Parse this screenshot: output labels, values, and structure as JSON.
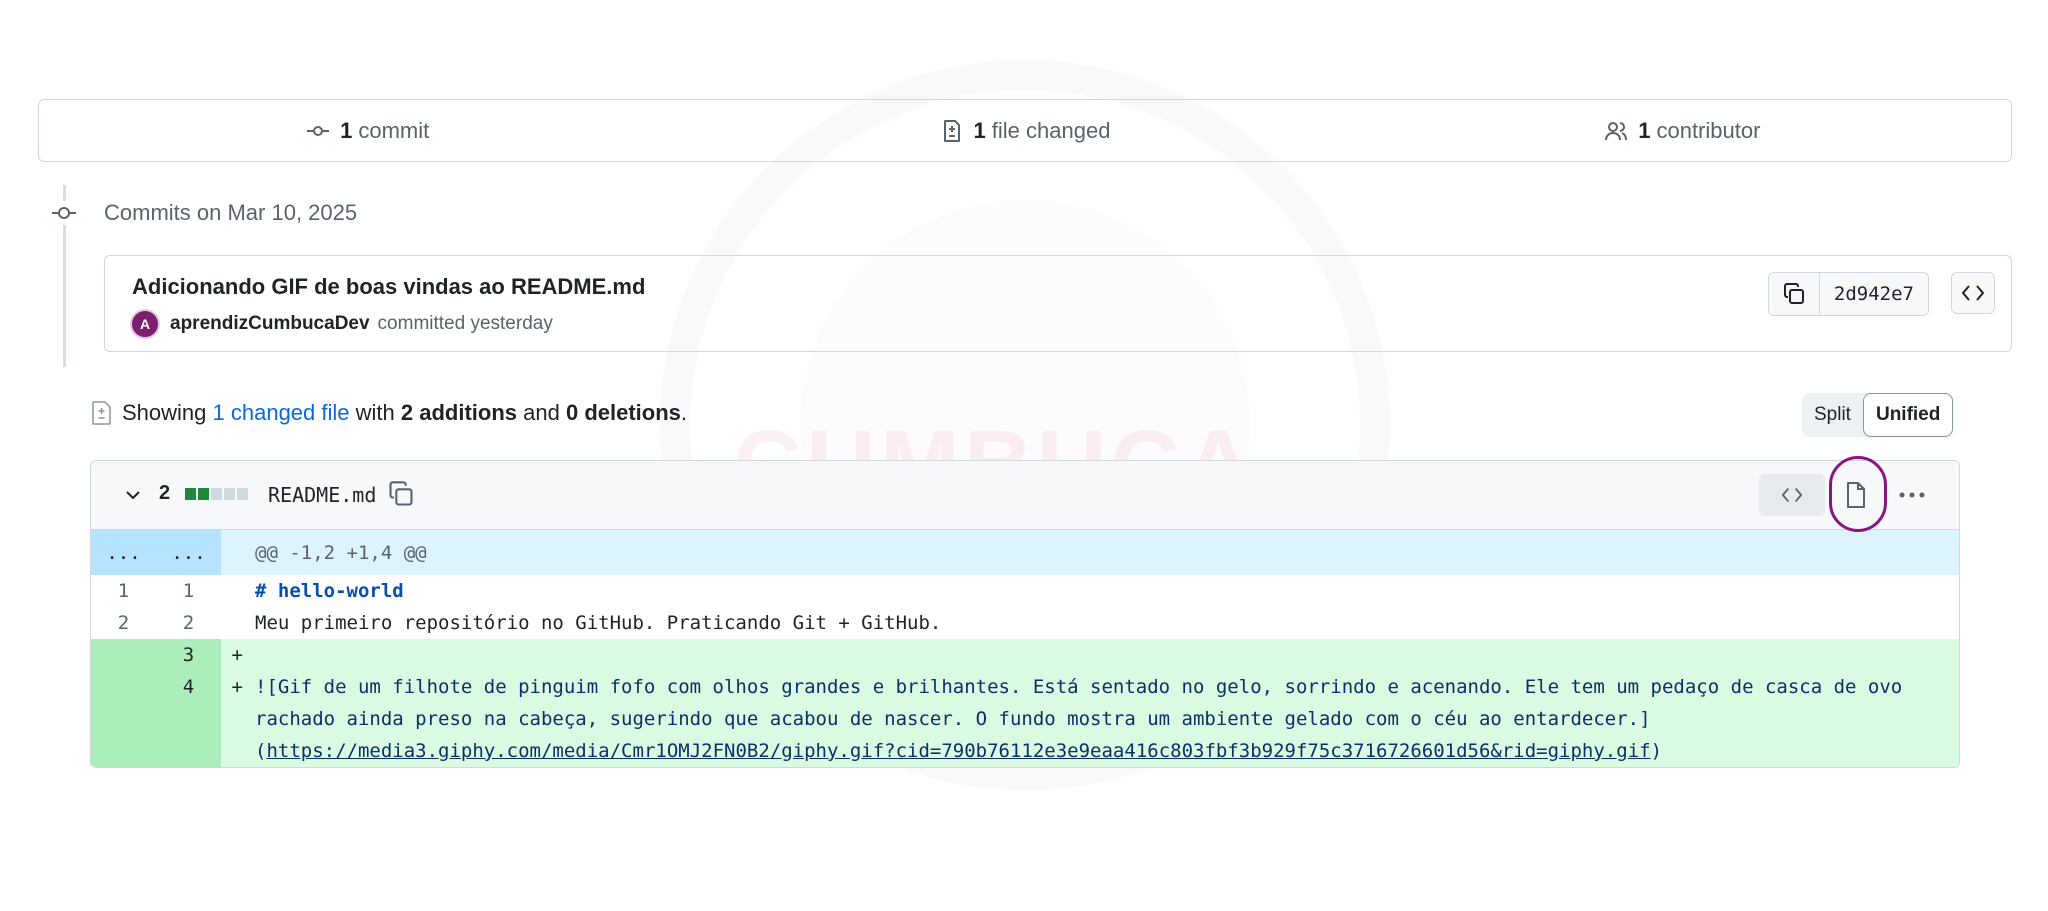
{
  "summary": {
    "commits_count": "1",
    "commits_label": "commit",
    "files_count": "1",
    "files_label": "file changed",
    "contributors_count": "1",
    "contributors_label": "contributor"
  },
  "timeline": {
    "date_heading": "Commits on Mar 10, 2025"
  },
  "commit": {
    "title": "Adicionando GIF de boas vindas ao README.md",
    "author": "aprendizCumbucaDev",
    "action": "committed yesterday",
    "sha": "2d942e7"
  },
  "showing": {
    "prefix": "Showing",
    "link": "1 changed file",
    "with": "with",
    "additions": "2 additions",
    "and": "and",
    "deletions": "0 deletions",
    "period": "."
  },
  "view_toggle": {
    "split": "Split",
    "unified": "Unified",
    "selected": "Unified"
  },
  "file": {
    "change_count": "2",
    "name": "README.md",
    "diffstat": [
      "add",
      "add",
      "neutral",
      "neutral",
      "neutral"
    ]
  },
  "diff": {
    "hunk_old": "...",
    "hunk_new": "...",
    "hunk_header": "@@ -1,2 +1,4 @@",
    "lines": [
      {
        "old": "1",
        "new": "1",
        "sign": "",
        "text": "# hello-world"
      },
      {
        "old": "2",
        "new": "2",
        "sign": "",
        "text": "Meu primeiro repositório no GitHub. Praticando Git + GitHub."
      },
      {
        "old": "",
        "new": "3",
        "sign": "+",
        "text": ""
      },
      {
        "old": "",
        "new": "4",
        "sign": "+",
        "text_prefix": "![Gif de um filhote de pinguim fofo com olhos grandes e brilhantes. Está sentado no gelo, sorrindo e acenando. Ele tem um pedaço de casca de ovo rachado ainda preso na cabeça, sugerindo que acabou de nascer. O fundo mostra um ambiente gelado com o céu ao entardecer.](",
        "link": "https://media3.giphy.com/media/Cmr1OMJ2FN0B2/giphy.gif?cid=790b76112e3e9eaa416c803fbf3b929f75c3716726601d56&rid=giphy.gif",
        "text_suffix": ")"
      }
    ]
  },
  "watermark": {
    "text": "CUMBUCA DEV"
  },
  "colors": {
    "accent": "#0969da",
    "add_bg": "#dafbe1",
    "add_num_bg": "#aceebb",
    "hunk_bg": "#ddf4ff",
    "diffstat_add": "#1f883d",
    "diffstat_neutral": "#d1d9e0",
    "highlight": "#8a1580"
  },
  "icons": {
    "commit": "git-commit-icon",
    "file_diff": "file-diff-icon",
    "people": "people-icon",
    "copy": "copy-icon",
    "code": "code-icon",
    "chevron": "chevron-down-icon",
    "file": "file-icon",
    "more": "kebab-horizontal-icon"
  }
}
